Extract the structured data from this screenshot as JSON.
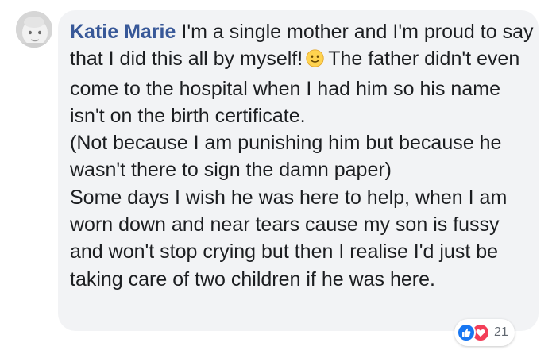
{
  "comment": {
    "author": "Katie Marie",
    "text_before_emoji": "I'm a single mother and I'm proud to say that I did this all by myself!",
    "emoji": "slightly-smiling-face-emoji",
    "text_after_emoji": "The father didn't even come to the hospital when I had him so his name isn't on the birth certificate.",
    "text_paragraph_2": "(Not because I am punishing him but because he wasn't there to sign the damn paper)",
    "text_paragraph_3": "Some days I wish he was here to help, when I am worn down and near tears cause my son is fussy and won't stop crying but then I realise I'd just be taking care of two children if he was here."
  },
  "reactions": {
    "icons": [
      "like-icon",
      "love-icon"
    ],
    "count": "21"
  },
  "colors": {
    "author": "#385898",
    "bubble_background": "#f2f3f5",
    "text": "#1c1e21",
    "like": "#1877f2",
    "love": "#f33e58"
  }
}
